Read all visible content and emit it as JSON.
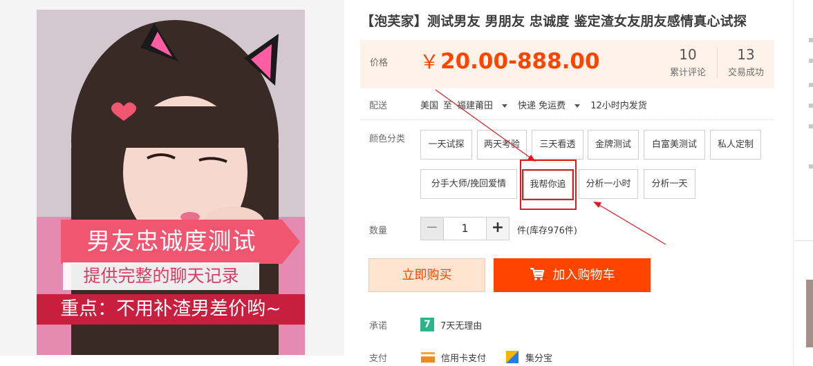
{
  "product": {
    "title": "【泡芙家】测试男友 男朋友 忠诚度 鉴定渣女友朋友感情真心试探",
    "image_promo": {
      "line1": "男友忠诚度测试",
      "line2": "提供完整的聊天记录",
      "line3": "重点：不用补渣男差价哟~"
    }
  },
  "price": {
    "label": "价格",
    "currency": "￥",
    "range": "20.00-888.00",
    "color": "#ff4400"
  },
  "stats": [
    {
      "num": "10",
      "label": "累计评论"
    },
    {
      "num": "13",
      "label": "交易成功"
    }
  ],
  "shipping": {
    "label": "配送",
    "origin": "美国",
    "to": "至",
    "destination": "福建莆田",
    "method": "快递 免运费",
    "time": "12小时内发货"
  },
  "options": {
    "label": "颜色分类",
    "items": [
      "一天试探",
      "两天考验",
      "三天看透",
      "金牌测试",
      "白富美测试",
      "私人定制",
      "分手大师/挽回爱情",
      "我帮你追",
      "分析一小时",
      "分析一天"
    ],
    "highlighted": "我帮你追",
    "highlight_color": "#e0191f"
  },
  "quantity": {
    "label": "数量",
    "minus": "−",
    "value": "1",
    "plus": "+",
    "stock": "件(库存976件)"
  },
  "actions": {
    "buy_now": "立即购买",
    "add_to_cart": "加入购物车"
  },
  "promise": {
    "label": "承诺",
    "icon_text": "7",
    "text": "7天无理由"
  },
  "payment": {
    "label": "支付",
    "method1": "信用卡支付",
    "method2": "集分宝"
  },
  "theme": {
    "accent": "#ff4400",
    "price_bg": "#fff2e8"
  }
}
